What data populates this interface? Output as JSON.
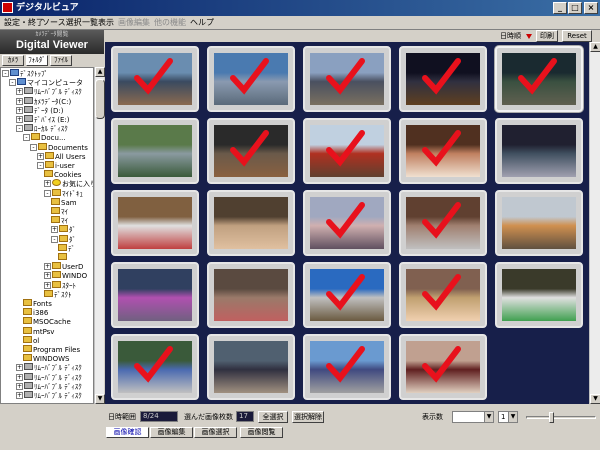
{
  "window": {
    "title": "デジタルビュア"
  },
  "menu": [
    {
      "label": "設定・終了",
      "enabled": true
    },
    {
      "label": "ソース選択",
      "enabled": true
    },
    {
      "label": "一覧表示",
      "enabled": true
    },
    {
      "label": "画像編集",
      "enabled": false
    },
    {
      "label": "他の機能",
      "enabled": false
    },
    {
      "label": "ヘルプ",
      "enabled": true
    }
  ],
  "sidebar": {
    "subtitle": "ｶﾒﾗﾃﾞｰﾀ閲覧",
    "title": "Digital Viewer",
    "tabs": [
      "ｶﾒﾗ",
      "ﾌｫﾙﾀﾞ",
      "ﾌｧｲﾙ"
    ],
    "active_tab": 1,
    "tree": [
      {
        "label": "ﾃﾞｽｸﾄｯﾌﾟ",
        "icon": "computer",
        "level": 0,
        "expander": "-"
      },
      {
        "label": "マイコンピュータ",
        "icon": "computer",
        "level": 1,
        "expander": "-"
      },
      {
        "label": "ﾘﾑｰﾊﾞﾌﾞﾙ ﾃﾞｨｽｸ",
        "icon": "drive",
        "level": 2,
        "expander": "+"
      },
      {
        "label": "ｶﾒﾗﾃﾞｰﾀ(C:)",
        "icon": "drive",
        "level": 2,
        "expander": "+"
      },
      {
        "label": "ﾃﾞｰﾀ (D:)",
        "icon": "drive",
        "level": 2,
        "expander": "+"
      },
      {
        "label": "ﾃﾞﾊﾞｲｽ (E:)",
        "icon": "drive",
        "level": 2,
        "expander": "+"
      },
      {
        "label": "ﾛｰｶﾙ ﾃﾞｨｽｸ",
        "icon": "drive",
        "level": 2,
        "expander": "-"
      },
      {
        "label": "Docu...",
        "icon": "folder",
        "level": 3,
        "expander": "-"
      },
      {
        "label": "Documents",
        "icon": "folder",
        "level": 4,
        "expander": "-"
      },
      {
        "label": "All Users",
        "icon": "folder",
        "level": 5,
        "expander": "+"
      },
      {
        "label": "i-user",
        "icon": "folder",
        "level": 5,
        "expander": "-"
      },
      {
        "label": "Cookies",
        "icon": "folder",
        "level": 6,
        "expander": ""
      },
      {
        "label": "お気に入り",
        "icon": "star",
        "level": 6,
        "expander": "+"
      },
      {
        "label": "ﾏｲﾄﾞｷｭ",
        "icon": "folder",
        "level": 6,
        "expander": "-"
      },
      {
        "label": "Sam",
        "icon": "folder",
        "level": 7,
        "expander": ""
      },
      {
        "label": "ﾏｲ",
        "icon": "folder",
        "level": 7,
        "expander": ""
      },
      {
        "label": "ﾏｲ",
        "icon": "folder",
        "level": 7,
        "expander": ""
      },
      {
        "label": "ﾀﾞ",
        "icon": "folder",
        "level": 7,
        "expander": "+"
      },
      {
        "label": "ﾀﾞ",
        "icon": "folder",
        "level": 7,
        "expander": "-"
      },
      {
        "label": "ﾃﾞ",
        "icon": "folder",
        "level": 8,
        "expander": ""
      },
      {
        "label": "",
        "icon": "folder",
        "level": 8,
        "expander": ""
      },
      {
        "label": "UserD",
        "icon": "folder",
        "level": 6,
        "expander": "+"
      },
      {
        "label": "WINDO",
        "icon": "folder",
        "level": 6,
        "expander": "+"
      },
      {
        "label": "ｽﾀｰﾄ",
        "icon": "folder",
        "level": 6,
        "expander": "+"
      },
      {
        "label": "ﾃﾞｽｸﾄ",
        "icon": "folder",
        "level": 6,
        "expander": ""
      },
      {
        "label": "Fonts",
        "icon": "folder",
        "level": 3,
        "expander": ""
      },
      {
        "label": "i386",
        "icon": "folder",
        "level": 3,
        "expander": ""
      },
      {
        "label": "MSOCache",
        "icon": "folder",
        "level": 3,
        "expander": ""
      },
      {
        "label": "mtPsv",
        "icon": "folder",
        "level": 3,
        "expander": ""
      },
      {
        "label": "ol",
        "icon": "folder",
        "level": 3,
        "expander": ""
      },
      {
        "label": "Program Files",
        "icon": "folder",
        "level": 3,
        "expander": ""
      },
      {
        "label": "WINDOWS",
        "icon": "folder",
        "level": 3,
        "expander": ""
      },
      {
        "label": "ﾘﾑｰﾊﾞﾌﾞﾙ ﾃﾞｨｽｸ",
        "icon": "drive",
        "level": 2,
        "expander": "+"
      },
      {
        "label": "ﾘﾑｰﾊﾞﾌﾞﾙ ﾃﾞｨｽｸ",
        "icon": "drive",
        "level": 2,
        "expander": "+"
      },
      {
        "label": "ﾘﾑｰﾊﾞﾌﾞﾙ ﾃﾞｨｽｸ",
        "icon": "drive",
        "level": 2,
        "expander": "+"
      },
      {
        "label": "ﾘﾑｰﾊﾞﾌﾞﾙ ﾃﾞｨｽｸ",
        "icon": "drive",
        "level": 2,
        "expander": "+"
      }
    ]
  },
  "toolbar": {
    "date_label": "日時順",
    "print_button": "印刷",
    "reset_button": "Reset"
  },
  "photos": [
    {
      "scene": "station plaza",
      "colors": [
        "#6a8db0",
        "#3a4a60",
        "#8a6a50"
      ],
      "checked": true,
      "selected": false
    },
    {
      "scene": "building",
      "colors": [
        "#4a7ab0",
        "#8a9ab0",
        "#5a6a7a"
      ],
      "checked": true,
      "selected": false
    },
    {
      "scene": "street",
      "colors": [
        "#8aa0c0",
        "#4a5060",
        "#7a7060"
      ],
      "checked": true,
      "selected": false
    },
    {
      "scene": "night street",
      "colors": [
        "#101020",
        "#303040",
        "#604020"
      ],
      "checked": true,
      "selected": false
    },
    {
      "scene": "cityscape",
      "colors": [
        "#1a2a30",
        "#3a5040",
        "#606050"
      ],
      "checked": true,
      "selected": true
    },
    {
      "scene": "river",
      "colors": [
        "#5a7a4a",
        "#8a9aa0",
        "#3a5a3a"
      ],
      "checked": false,
      "selected": false
    },
    {
      "scene": "hall",
      "colors": [
        "#2a2a2a",
        "#6a5a4a",
        "#8a6040"
      ],
      "checked": true,
      "selected": false
    },
    {
      "scene": "torii gate",
      "colors": [
        "#c0d0e0",
        "#b03020",
        "#604030"
      ],
      "checked": true,
      "selected": false
    },
    {
      "scene": "festival",
      "colors": [
        "#503020",
        "#c08060",
        "#f0e0d0"
      ],
      "checked": true,
      "selected": false
    },
    {
      "scene": "audience",
      "colors": [
        "#202030",
        "#405060",
        "#a0a0b0"
      ],
      "checked": false,
      "selected": false
    },
    {
      "scene": "parade",
      "colors": [
        "#806040",
        "#e0e0e0",
        "#c04040"
      ],
      "checked": false,
      "selected": false
    },
    {
      "scene": "market",
      "colors": [
        "#504030",
        "#c0a080",
        "#e0c0a0"
      ],
      "checked": false,
      "selected": false
    },
    {
      "scene": "blossoms",
      "colors": [
        "#a0a8c0",
        "#d0b0b0",
        "#605060"
      ],
      "checked": true,
      "selected": false
    },
    {
      "scene": "crowd",
      "colors": [
        "#604030",
        "#a08070",
        "#c0c0c0"
      ],
      "checked": true,
      "selected": false
    },
    {
      "scene": "dog",
      "colors": [
        "#c0c8d0",
        "#d09050",
        "#605040"
      ],
      "checked": false,
      "selected": false
    },
    {
      "scene": "float",
      "colors": [
        "#304060",
        "#b050b0",
        "#706080"
      ],
      "checked": false,
      "selected": false
    },
    {
      "scene": "crowd street",
      "colors": [
        "#5a4a40",
        "#9a7a6a",
        "#c06060"
      ],
      "checked": false,
      "selected": false
    },
    {
      "scene": "blue sky",
      "colors": [
        "#2a6ac0",
        "#c0c0c0",
        "#6a5a40"
      ],
      "checked": true,
      "selected": false
    },
    {
      "scene": "procession",
      "colors": [
        "#806050",
        "#c0a070",
        "#f0d0b0"
      ],
      "checked": true,
      "selected": false
    },
    {
      "scene": "decorated float",
      "colors": [
        "#3a3a2a",
        "#e0e0e0",
        "#40a050"
      ],
      "checked": false,
      "selected": false
    },
    {
      "scene": "dancers",
      "colors": [
        "#3a5a3a",
        "#4a6ab0",
        "#c0c0c0"
      ],
      "checked": true,
      "selected": false
    },
    {
      "scene": "march",
      "colors": [
        "#506070",
        "#303040",
        "#a09080"
      ],
      "checked": false,
      "selected": false
    },
    {
      "scene": "parade street",
      "colors": [
        "#6a9ad0",
        "#404a80",
        "#a0a0a0"
      ],
      "checked": true,
      "selected": false
    },
    {
      "scene": "doll",
      "colors": [
        "#c0a090",
        "#602020",
        "#e0d0c0"
      ],
      "checked": true,
      "selected": false
    }
  ],
  "status": {
    "date_label": "日時範囲",
    "date_value": "8/24",
    "count_label": "選んだ画像枚数",
    "count_value": "17",
    "release_button": "全選択",
    "sort_button": "選択解除",
    "display_label": "表示数",
    "display_value": "",
    "page_value": "1",
    "zoom_level": 0.35
  },
  "bottom_tabs": [
    {
      "label": "画像確認",
      "active": true
    },
    {
      "label": "画像編集",
      "active": false
    },
    {
      "label": "画像選択",
      "active": false
    },
    {
      "label": "画像閲覧",
      "active": false
    }
  ]
}
